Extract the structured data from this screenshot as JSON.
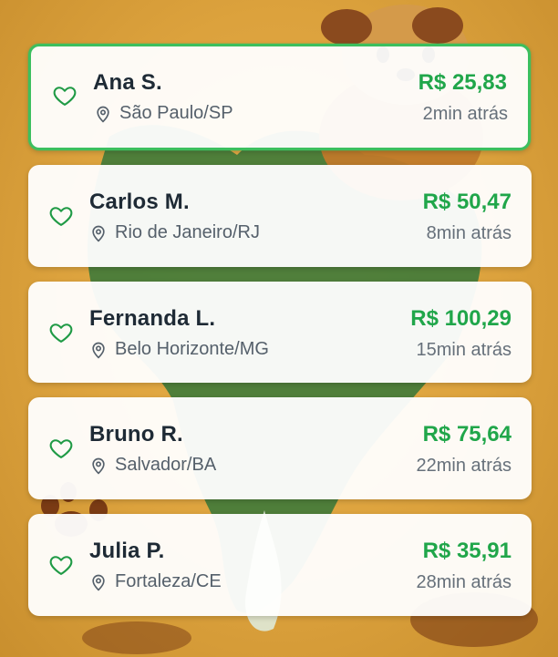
{
  "background": {
    "mascot": "dog-mascot-illustration",
    "map": "brazil-map-illustration",
    "paw": "paw-print-illustration"
  },
  "colors": {
    "accent_green": "#20a64a",
    "active_border": "#3cbf5e",
    "background_gold": "#dca23d"
  },
  "feed": {
    "items": [
      {
        "name": "Ana S.",
        "location": "São Paulo/SP",
        "amount": "R$ 25,83",
        "time": "2min atrás",
        "highlighted": true
      },
      {
        "name": "Carlos M.",
        "location": "Rio de Janeiro/RJ",
        "amount": "R$ 50,47",
        "time": "8min atrás",
        "highlighted": false
      },
      {
        "name": "Fernanda L.",
        "location": "Belo Horizonte/MG",
        "amount": "R$ 100,29",
        "time": "15min atrás",
        "highlighted": false
      },
      {
        "name": "Bruno R.",
        "location": "Salvador/BA",
        "amount": "R$ 75,64",
        "time": "22min atrás",
        "highlighted": false
      },
      {
        "name": "Julia P.",
        "location": "Fortaleza/CE",
        "amount": "R$ 35,91",
        "time": "28min atrás",
        "highlighted": false
      }
    ]
  }
}
